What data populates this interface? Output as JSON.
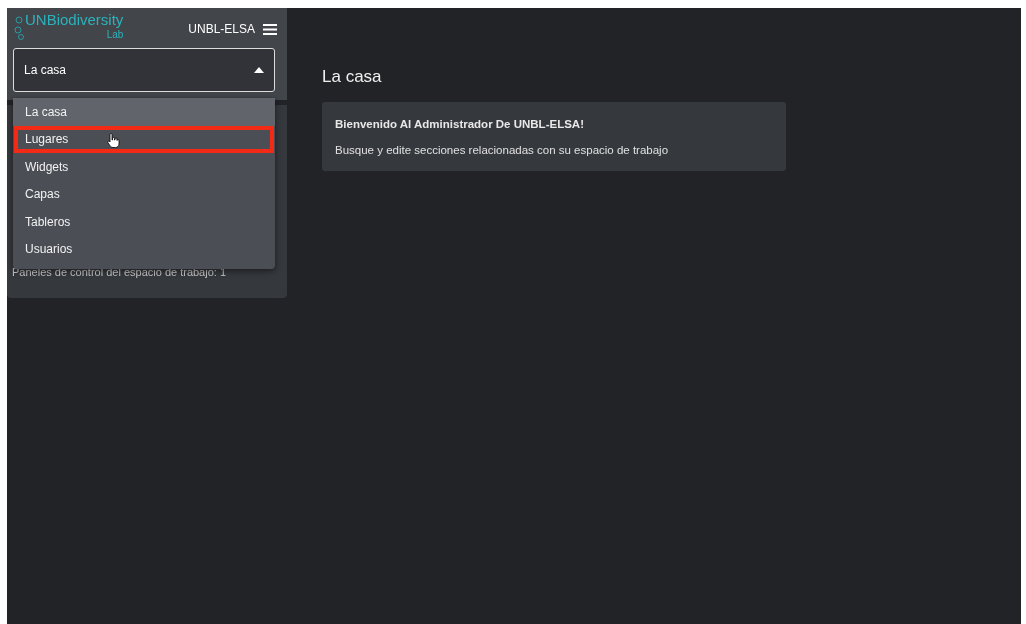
{
  "sidebar": {
    "logo": {
      "brand": "UNBiodiversity",
      "sub": "Lab"
    },
    "workspace": "UNBL-ELSA",
    "select": {
      "value": "La casa",
      "expanded": true
    },
    "menu": [
      {
        "label": "La casa",
        "selected": true,
        "highlighted": false
      },
      {
        "label": "Lugares",
        "selected": false,
        "highlighted": true
      },
      {
        "label": "Widgets",
        "selected": false,
        "highlighted": false
      },
      {
        "label": "Capas",
        "selected": false,
        "highlighted": false
      },
      {
        "label": "Tableros",
        "selected": false,
        "highlighted": false
      },
      {
        "label": "Usuarios",
        "selected": false,
        "highlighted": false
      }
    ],
    "stats": [
      "Paneles de control del espacio de trabajo: 1"
    ]
  },
  "main": {
    "title": "La casa",
    "card": {
      "heading": "Bienvenido Al Administrador De UNBL-ELSA!",
      "text": "Busque y edite secciones relacionadas con su espacio de trabajo"
    }
  }
}
